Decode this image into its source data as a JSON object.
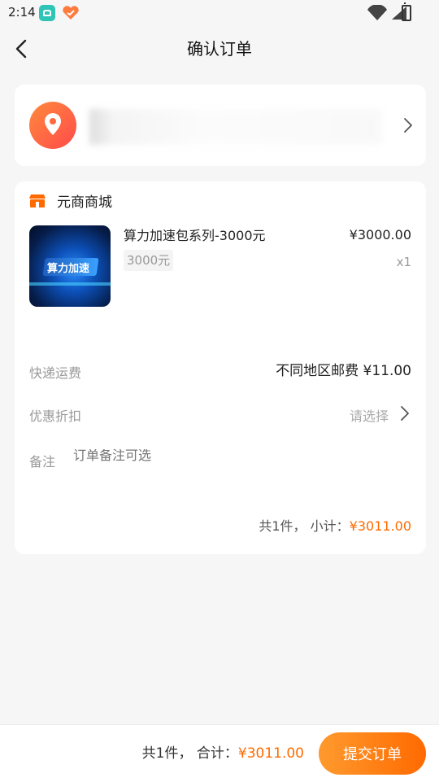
{
  "status_bar": {
    "time": "2:14"
  },
  "header": {
    "title": "确认订单"
  },
  "order": {
    "shop_name": "元商商城",
    "product": {
      "name": "算力加速包系列-3000元",
      "spec": "3000元",
      "price": "¥3000.00",
      "quantity": "x1",
      "image_text": "算力加速"
    },
    "shipping": {
      "label": "快递运费",
      "value": "不同地区邮费 ¥11.00"
    },
    "discount": {
      "label": "优惠折扣",
      "value": "请选择"
    },
    "remark": {
      "label": "备注",
      "placeholder": "订单备注可选"
    },
    "subtotal": {
      "prefix": "共1件，  小计：",
      "amount": "¥3011.00"
    }
  },
  "bottom_bar": {
    "total_prefix": "共1件，  合计：",
    "total_amount": "¥3011.00",
    "submit_label": "提交订单"
  },
  "colors": {
    "accent": "#ff6a00",
    "background": "#f6f6f6"
  },
  "icons": {
    "back": "chevron-left-icon",
    "location": "location-pin-icon",
    "shop": "store-icon",
    "chevron": "chevron-right-icon"
  }
}
